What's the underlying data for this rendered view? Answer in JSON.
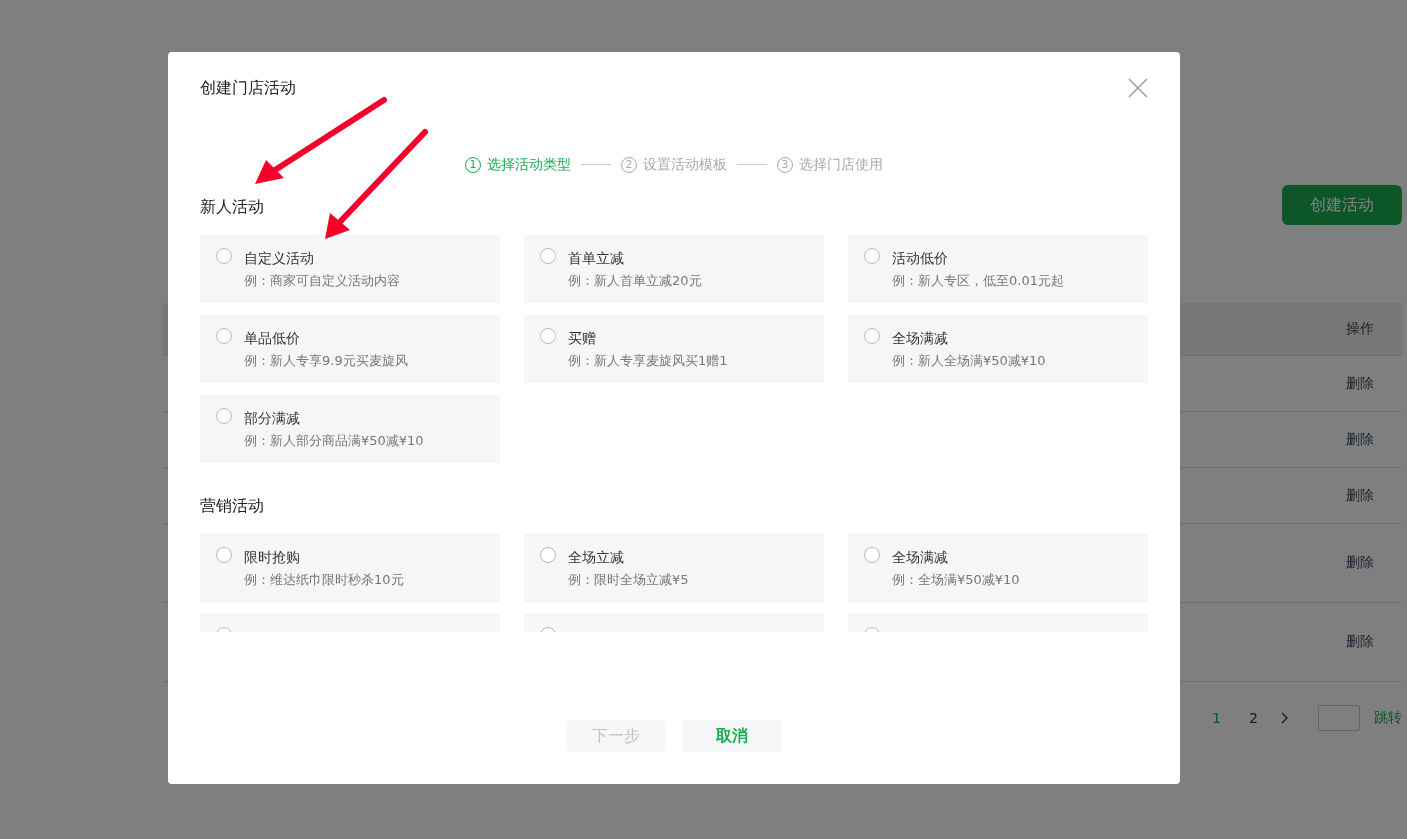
{
  "background": {
    "create_button": "创建活动",
    "table": {
      "header": "操作",
      "rows": [
        {
          "action": "删除",
          "tall": false
        },
        {
          "action": "删除",
          "tall": false
        },
        {
          "action": "删除",
          "tall": false
        },
        {
          "action": "删除",
          "tall": true
        },
        {
          "action": "删除",
          "tall": true
        }
      ]
    },
    "pagination": {
      "pages": [
        {
          "label": "1",
          "selected": true
        },
        {
          "label": "2",
          "selected": false
        }
      ],
      "jump": "跳转"
    }
  },
  "dialog": {
    "title": "创建门店活动",
    "steps": [
      {
        "number": "1",
        "label": "选择活动类型",
        "selected": true
      },
      {
        "number": "2",
        "label": "设置活动模板",
        "selected": false
      },
      {
        "number": "3",
        "label": "选择门店使用",
        "selected": false
      }
    ],
    "sections": [
      {
        "title": "新人活动",
        "options": [
          {
            "title": "自定义活动",
            "example": "例：商家可自定义活动内容",
            "selected": false
          },
          {
            "title": "首单立减",
            "example": "例：新人首单立减20元",
            "selected": false
          },
          {
            "title": "活动低价",
            "example": "例：新人专区，低至0.01元起",
            "selected": false
          },
          {
            "title": "单品低价",
            "example": "例：新人专享9.9元买麦旋风",
            "selected": false
          },
          {
            "title": "买赠",
            "example": "例：新人专享麦旋风买1赠1",
            "selected": false
          },
          {
            "title": "全场满减",
            "example": "例：新人全场满¥50减¥10",
            "selected": false
          },
          {
            "title": "部分满减",
            "example": "例：新人部分商品满¥50减¥10",
            "selected": false
          }
        ]
      },
      {
        "title": "营销活动",
        "options": [
          {
            "title": "限时抢购",
            "example": "例：维达纸巾限时秒杀10元",
            "selected": false
          },
          {
            "title": "全场立减",
            "example": "例：限时全场立减¥5",
            "selected": false
          },
          {
            "title": "全场满减",
            "example": "例：全场满¥50减¥10",
            "selected": false
          },
          {
            "selected": false
          },
          {
            "selected": false
          },
          {
            "selected": false
          }
        ]
      }
    ],
    "buttons": [
      {
        "label": "下一步",
        "disabled": true
      },
      {
        "label": "取消",
        "disabled": false
      }
    ]
  }
}
